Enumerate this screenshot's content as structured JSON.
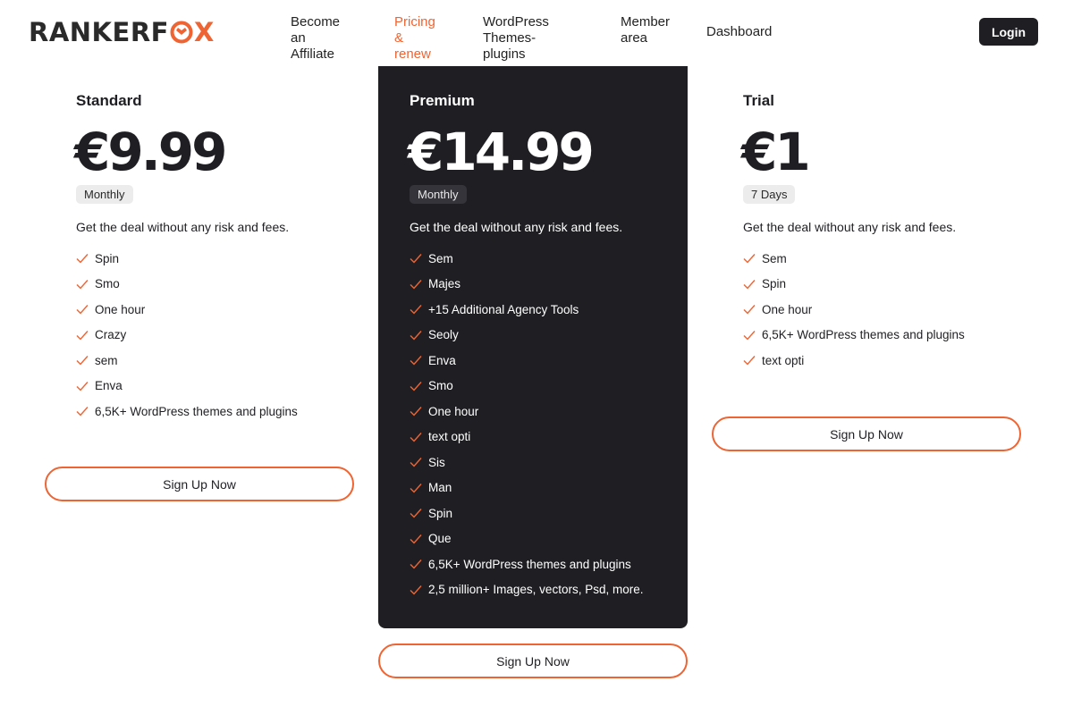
{
  "brand": {
    "name_part1": "RANKERF",
    "name_part2": "X",
    "accent_color": "#ee6433",
    "dark_color": "#1f1f23"
  },
  "nav": {
    "items": [
      {
        "label": "Become\nan Affiliate",
        "active": false
      },
      {
        "label": "Pricing\n& renew",
        "active": true
      },
      {
        "label": "WordPress\nThemes-plugins",
        "active": false
      },
      {
        "label": "Member\narea",
        "active": false
      },
      {
        "label": "Dashboard",
        "active": false
      }
    ],
    "login_label": "Login"
  },
  "plans": [
    {
      "name": "Standard",
      "price": "€9.99",
      "period": "Monthly",
      "description": "Get the deal without any risk and fees.",
      "features": [
        "Spin",
        "Smo",
        "One hour",
        "Crazy",
        "sem",
        "Enva",
        "6,5K+ WordPress themes and plugins"
      ],
      "cta": "Sign Up Now",
      "featured": false
    },
    {
      "name": "Premium",
      "price": "€14.99",
      "period": "Monthly",
      "description": "Get the deal without any risk and fees.",
      "features": [
        "Sem",
        "Majes",
        "+15 Additional Agency Tools",
        "Seoly",
        "Enva",
        "Smo",
        "One hour",
        "text opti",
        "Sis",
        "Man",
        "Spin",
        "Que",
        "6,5K+ WordPress themes and plugins",
        "2,5 million+ Images, vectors, Psd, more."
      ],
      "cta": "Sign Up Now",
      "featured": true
    },
    {
      "name": "Trial",
      "price": "€1",
      "period": "7 Days",
      "description": "Get the deal without any risk and fees.",
      "features": [
        "Sem",
        "Spin",
        "One hour",
        "6,5K+ WordPress themes and plugins",
        "text opti"
      ],
      "cta": "Sign Up Now",
      "featured": false
    }
  ]
}
